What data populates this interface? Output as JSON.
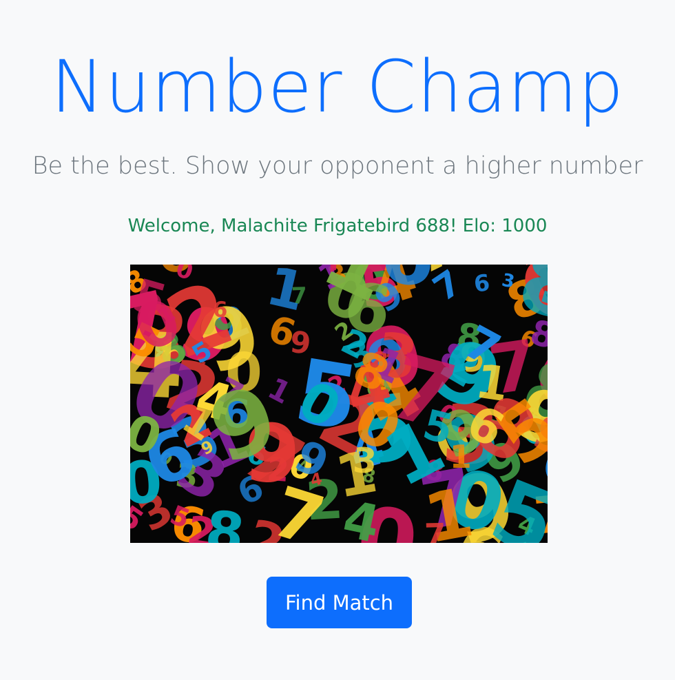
{
  "header": {
    "title": "Number Champ",
    "subtitle": "Be the best. Show your opponent a higher number"
  },
  "user": {
    "welcome_text": "Welcome, Malachite Frigatebird 688! Elo: 1000"
  },
  "hero_image": {
    "icon": "colorful-numbers-image",
    "palette": [
      "#e53935",
      "#1e88e5",
      "#fdd835",
      "#43a047",
      "#fb8c00",
      "#8e24aa",
      "#00acc1",
      "#d81b60",
      "#7cb342"
    ]
  },
  "actions": {
    "find_match_label": "Find Match"
  },
  "colors": {
    "title": "#0d6efd",
    "subtitle": "#6c757d",
    "welcome": "#198754",
    "button": "#0d6efd",
    "background": "#f8f9fa"
  }
}
